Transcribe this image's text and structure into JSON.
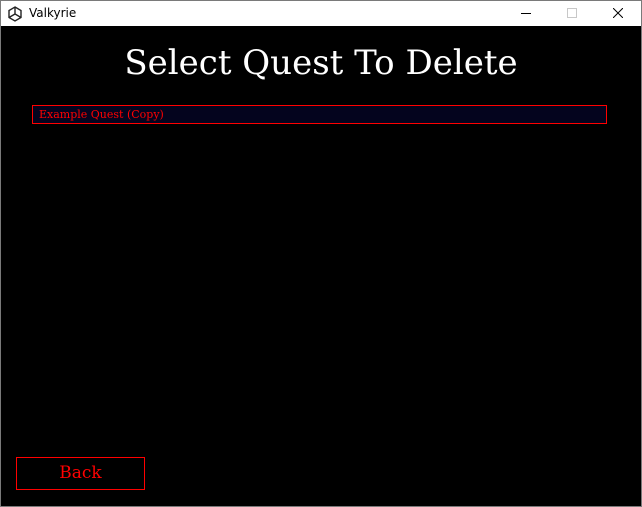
{
  "window": {
    "title": "Valkyrie",
    "icons": {
      "app": "unity-icon",
      "minimize": "minimize-icon",
      "maximize": "maximize-icon",
      "close": "close-icon"
    }
  },
  "screen": {
    "heading": "Select Quest To Delete",
    "quests": [
      {
        "label": "Example Quest (Copy)"
      }
    ],
    "back_label": "Back"
  },
  "colors": {
    "background": "#000000",
    "accent": "#ff0000",
    "list_item_bg": "#04041e",
    "heading": "#ffffff"
  }
}
